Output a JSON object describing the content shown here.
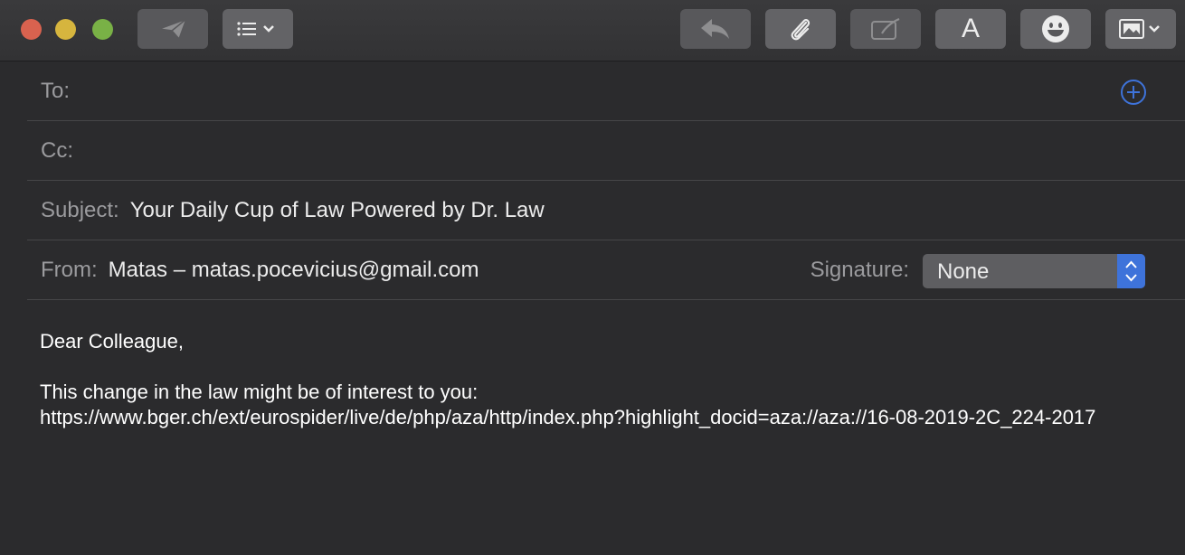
{
  "toolbar": {
    "buttons": [
      {
        "name": "send",
        "icon": "paper-plane-icon"
      },
      {
        "name": "header-fields",
        "icon": "list-icon"
      },
      {
        "name": "reply",
        "icon": "reply-arrow-icon"
      },
      {
        "name": "attach",
        "icon": "paperclip-icon"
      },
      {
        "name": "markup",
        "icon": "markup-icon"
      },
      {
        "name": "format",
        "icon": "font-icon",
        "label": "A"
      },
      {
        "name": "emoji",
        "icon": "smiley-icon"
      },
      {
        "name": "photo",
        "icon": "photo-browser-icon"
      }
    ]
  },
  "header": {
    "to_label": "To:",
    "to_value": "",
    "cc_label": "Cc:",
    "cc_value": "",
    "subject_label": "Subject:",
    "subject_value": "Your Daily Cup of Law Powered by Dr. Law",
    "from_label": "From:",
    "from_value": "Matas – matas.pocevicius@gmail.com",
    "signature_label": "Signature:",
    "signature_value": "None"
  },
  "body": {
    "greeting": "Dear Colleague,",
    "line1": "This change in the law might be of interest to you:",
    "url": "https://www.bger.ch/ext/eurospider/live/de/php/aza/http/index.php?highlight_docid=aza://aza://16-08-2019-2C_224-2017"
  },
  "colors": {
    "accent": "#3e73da",
    "background": "#2b2b2d",
    "toolbar": "#323234"
  }
}
